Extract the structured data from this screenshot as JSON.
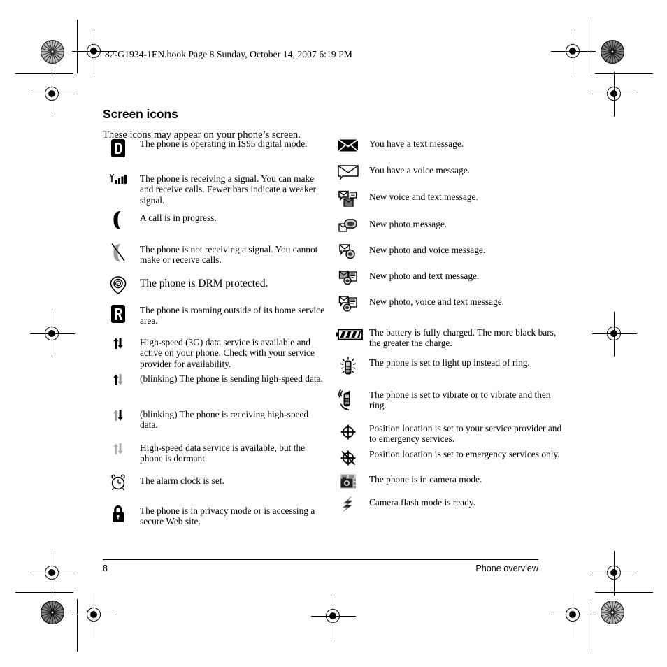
{
  "book_header": "82-G1934-1EN.book  Page 8  Sunday, October 14, 2007  6:19 PM",
  "page_title": "Screen icons",
  "intro": "These icons may appear on your phone’s screen.",
  "footer": {
    "page_number": "8",
    "section": "Phone overview"
  },
  "colors": {
    "ink": "#000000",
    "gray_icon": "#9a9a9a",
    "mid_gray": "#6e6e6e",
    "page": "#ffffff"
  },
  "left_column": [
    {
      "icon": "digital-mode-d-icon",
      "text": "The phone is operating in IS95 digital mode.",
      "emphasis": "normal"
    },
    {
      "icon": "signal-bars-icon",
      "text": "The phone is receiving a signal. You can make and receive calls. Fewer bars indicate a weaker signal.",
      "emphasis": "normal"
    },
    {
      "icon": "call-in-progress-handset-icon",
      "text": "A call is in progress.",
      "emphasis": "normal"
    },
    {
      "icon": "no-signal-handset-slash-icon",
      "text": "The phone is not receiving a signal. You cannot make or receive calls.",
      "emphasis": "normal"
    },
    {
      "icon": "drm-copyright-icon",
      "text": "The phone is DRM protected.",
      "emphasis": "large"
    },
    {
      "icon": "roaming-r-icon",
      "text": "The phone is roaming outside of its home service area.",
      "emphasis": "normal"
    },
    {
      "icon": "highspeed-data-active-icon",
      "text": "High-speed (3G) data service is available and active on your phone. Check with your service provider for availability.",
      "emphasis": "normal"
    },
    {
      "icon": "highspeed-data-sending-icon",
      "text": "(blinking) The phone is sending high-speed data.",
      "emphasis": "normal"
    },
    {
      "icon": "highspeed-data-receiving-icon",
      "text": "(blinking) The phone is receiving high-speed data.",
      "emphasis": "normal"
    },
    {
      "icon": "highspeed-data-dormant-icon",
      "text": "High-speed data service is available, but the phone is dormant.",
      "emphasis": "normal"
    },
    {
      "icon": "alarm-clock-icon",
      "text": "The alarm clock is set.",
      "emphasis": "normal"
    },
    {
      "icon": "privacy-lock-icon",
      "text": "The phone is in privacy mode or is accessing a secure Web site.",
      "emphasis": "normal"
    }
  ],
  "right_column": [
    {
      "icon": "text-message-envelope-icon",
      "text": "You have a text message."
    },
    {
      "icon": "voice-message-envelope-icon",
      "text": "You have a voice message."
    },
    {
      "icon": "voice-and-text-message-icon",
      "text": "New voice and text message."
    },
    {
      "icon": "photo-message-icon",
      "text": "New photo message."
    },
    {
      "icon": "photo-and-voice-message-icon",
      "text": "New photo and voice message."
    },
    {
      "icon": "photo-and-text-message-icon",
      "text": "New photo and text message."
    },
    {
      "icon": "photo-voice-and-text-message-icon",
      "text": "New photo, voice and text message."
    },
    {
      "icon": "battery-full-icon",
      "text": "The battery is fully charged. The more black bars, the greater the charge."
    },
    {
      "icon": "light-up-phone-icon",
      "text": "The phone is set to light up instead of ring."
    },
    {
      "icon": "vibrate-phone-icon",
      "text": "The phone is set to vibrate or to vibrate and then ring."
    },
    {
      "icon": "position-location-full-icon",
      "text": "Position location is set to your service provider and to emergency services."
    },
    {
      "icon": "position-location-emergency-only-icon",
      "text": "Position location is set to emergency services only."
    },
    {
      "icon": "camera-mode-icon",
      "text": "The phone is in camera mode."
    },
    {
      "icon": "camera-flash-ready-icon",
      "text": "Camera flash mode is ready."
    }
  ]
}
